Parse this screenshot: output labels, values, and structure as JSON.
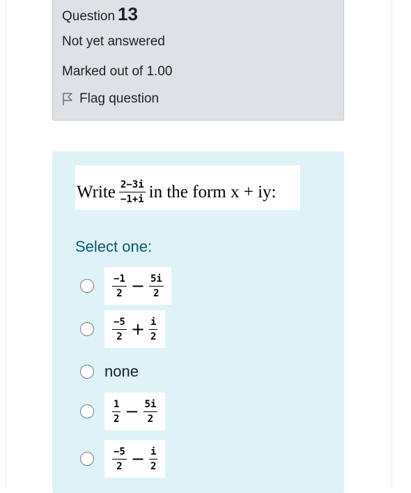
{
  "info": {
    "question_label": "Question",
    "question_number": "13",
    "status": "Not yet answered",
    "marks": "Marked out of 1.00",
    "flag_label": "Flag question"
  },
  "question": {
    "prefix": "Write",
    "fraction_num": "2−3i",
    "fraction_den": "−1+i",
    "suffix": "in the form x + iy:",
    "cut_text": ". . . .",
    "select_prompt": "Select one:"
  },
  "options": [
    {
      "kind": "expr",
      "a_num": "−1",
      "a_den": "2",
      "op": "−",
      "b_num": "5i",
      "b_den": "2"
    },
    {
      "kind": "expr",
      "a_num": "−5",
      "a_den": "2",
      "op": "+",
      "b_num": "i",
      "b_den": "2"
    },
    {
      "kind": "text",
      "label": "none"
    },
    {
      "kind": "expr",
      "a_num": "1",
      "a_den": "2",
      "op": "−",
      "b_num": "5i",
      "b_den": "2"
    },
    {
      "kind": "expr",
      "a_num": "−5",
      "a_den": "2",
      "op": "−",
      "b_num": "i",
      "b_den": "2"
    }
  ],
  "colors": {
    "info_bg": "#dee2e6",
    "content_bg": "#def2f8",
    "prompt_color": "#0b5a6b"
  },
  "icons": {
    "flag": "flag-outline-icon",
    "radio": "radio-unchecked-icon"
  }
}
